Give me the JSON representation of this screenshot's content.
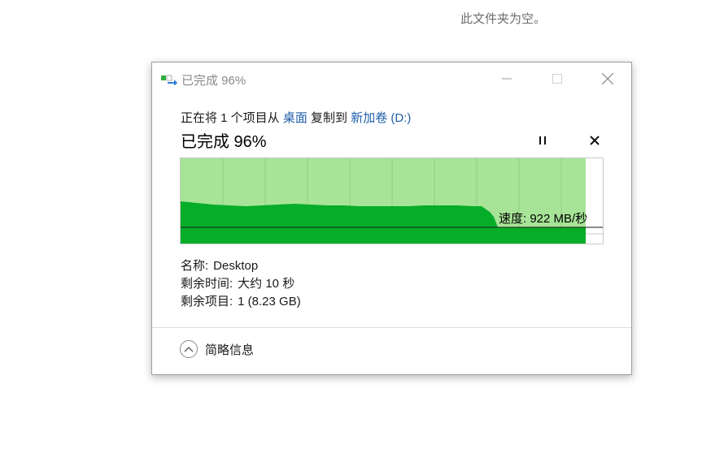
{
  "background": {
    "empty_folder_text": "此文件夹为空。"
  },
  "dialog": {
    "window_title": "已完成 96%",
    "copy_line": {
      "prefix": "正在将 1 个项目从 ",
      "source": "桌面",
      "middle": " 复制到 ",
      "destination": "新加卷 (D:)"
    },
    "status": "已完成 96%",
    "progress_percent": 96,
    "speed": "速度: 922 MB/秒",
    "details": {
      "name_label": "名称:",
      "name_value": "Desktop",
      "time_label": "剩余时间:",
      "time_value": "大约 10 秒",
      "items_label": "剩余项目:",
      "items_value": "1 (8.23 GB)"
    },
    "toggle_details_label": "简略信息",
    "colors": {
      "progress_light": "#a7e497",
      "progress_dark": "#06ad28",
      "grid_line": "#8fcf80",
      "link": "#1f5ea8"
    },
    "icons": {
      "title": "copy-transfer-icon",
      "minimize": "minimize-icon",
      "maximize": "maximize-icon",
      "close": "close-icon",
      "pause": "pause-icon",
      "cancel": "cancel-icon",
      "toggle": "chevron-up-icon"
    }
  }
}
